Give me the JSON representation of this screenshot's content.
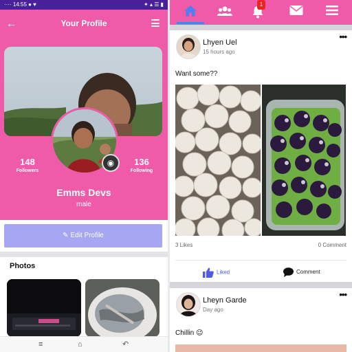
{
  "status_bar": {
    "left": "···· 14:55 ● ♥",
    "right": "✦ ▴ ☰ ▮"
  },
  "profile_header": {
    "back_icon": "arrow-left-icon",
    "title": "Your Profile",
    "menu_icon": "hamburger-icon"
  },
  "profile": {
    "name": "Emms Devs",
    "gender": "male",
    "followers_count": "148",
    "followers_label": "Followers",
    "following_count": "136",
    "following_label": "Following",
    "camera_icon": "camera-icon",
    "edit_button_label": "Edit Profile",
    "edit_icon": "pencil-icon"
  },
  "photos": {
    "title": "Photos"
  },
  "android_nav": {
    "menu_icon": "recent-apps-icon",
    "home_icon": "home-outline-icon",
    "back_icon": "back-icon"
  },
  "feed_nav": {
    "tabs": [
      {
        "name": "home",
        "icon": "home-icon",
        "active": true
      },
      {
        "name": "friends",
        "icon": "users-icon",
        "active": false
      },
      {
        "name": "notifications",
        "icon": "bell-icon",
        "active": false
      },
      {
        "name": "messages",
        "icon": "envelope-icon",
        "active": false
      },
      {
        "name": "menu",
        "icon": "hamburger-icon",
        "active": false
      }
    ],
    "notification_badge": "1"
  },
  "posts": [
    {
      "author": "Lhyen Uel",
      "time": "15 hours ago",
      "text": "Want some??",
      "likes_label": "3 Likes",
      "comments_label": "0 Comment",
      "like_action": "Liked",
      "comment_action": "Comment",
      "more_icon": "more-horizontal-icon"
    },
    {
      "author": "Lheyn Garde",
      "time": "Day ago",
      "text": "Chillin 😉",
      "more_icon": "more-horizontal-icon"
    }
  ],
  "colors": {
    "brand_pink": "#ef5aa9",
    "status_purple": "#4a1f9a",
    "accent_blue": "#4f7ff0",
    "edit_button": "#a7a6f2",
    "badge_red": "#e22222"
  }
}
